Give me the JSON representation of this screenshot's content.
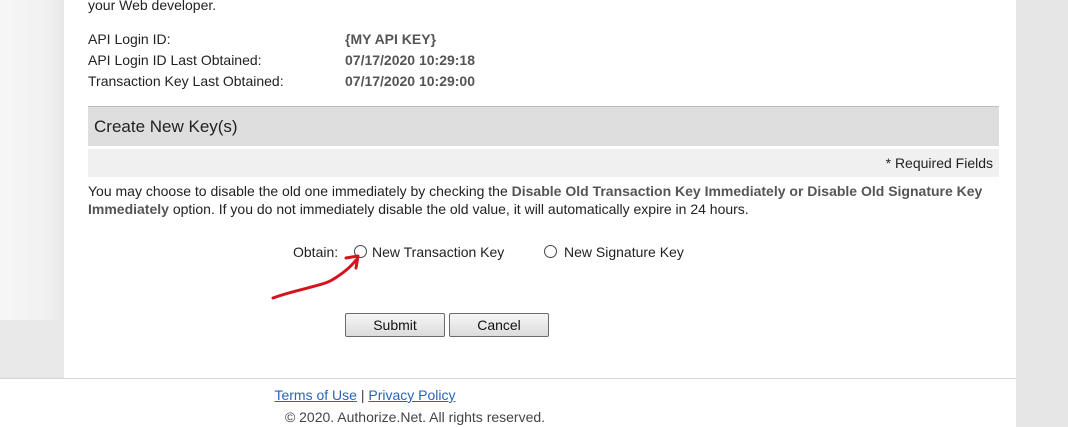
{
  "intro_tail": "your Web developer.",
  "info": [
    {
      "label": "API Login ID:",
      "value": "{MY API KEY}"
    },
    {
      "label": "API Login ID Last Obtained:",
      "value": "07/17/2020 10:29:18"
    },
    {
      "label": "Transaction Key Last Obtained:",
      "value": "07/17/2020 10:29:00"
    }
  ],
  "section_title": "Create New Key(s)",
  "required_note": "* Required Fields",
  "description": {
    "part1": "You may choose to disable the old one immediately by checking the ",
    "bold1": "Disable Old Transaction Key Immediately or Disable Old Signature Key Immediately",
    "part2": " option. If you do not immediately disable the old value, it will automatically expire in 24 hours."
  },
  "obtain": {
    "label": "Obtain:",
    "options": [
      "New Transaction Key",
      "New Signature Key"
    ]
  },
  "buttons": {
    "submit": "Submit",
    "cancel": "Cancel"
  },
  "footer": {
    "terms": "Terms of Use",
    "separator": "|",
    "privacy": "Privacy Policy",
    "copyright": "© 2020. Authorize.Net. All rights reserved."
  },
  "colors": {
    "annotation_arrow": "#d4141c",
    "link": "#2a63b7"
  }
}
